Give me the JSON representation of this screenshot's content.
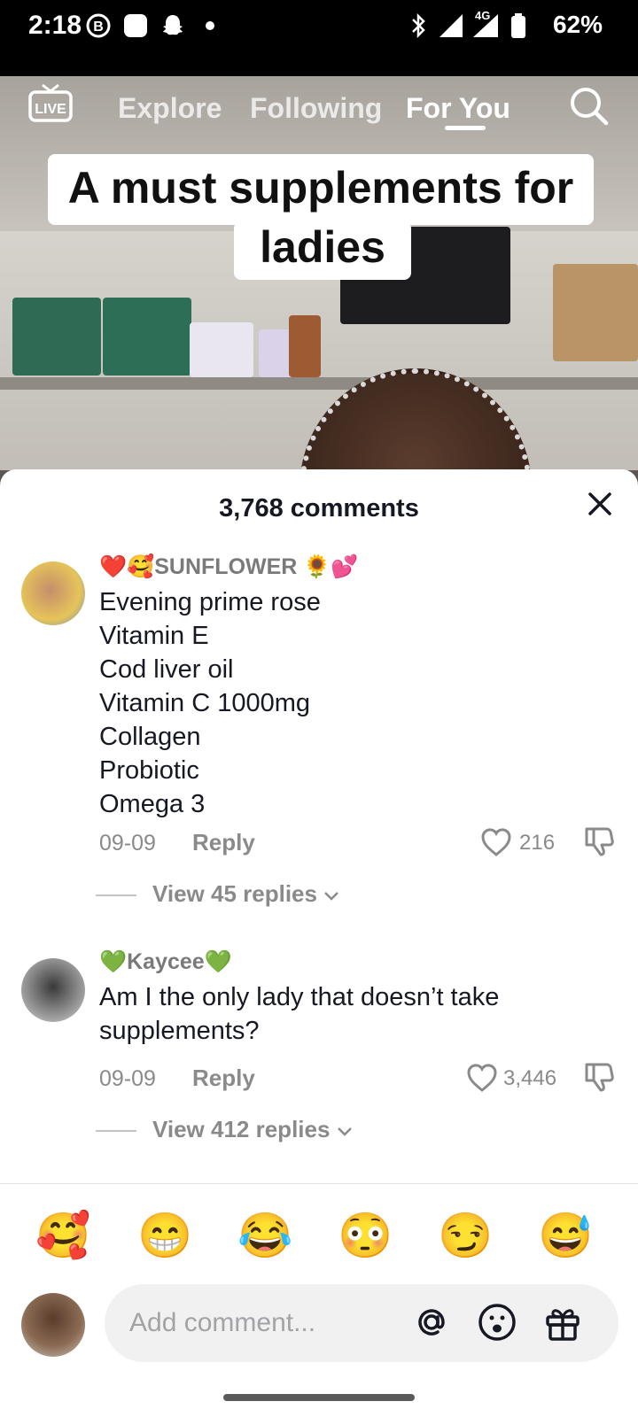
{
  "status_bar": {
    "time": "2:18",
    "battery": "62%",
    "network": "4G"
  },
  "top_nav": {
    "tabs": [
      {
        "label": "Explore",
        "active": false
      },
      {
        "label": "Following",
        "active": false
      },
      {
        "label": "For You",
        "active": true
      }
    ],
    "live_icon": "LIVE"
  },
  "video": {
    "caption_line1": "A must supplements for",
    "caption_line2": "ladies"
  },
  "comments_sheet": {
    "title": "3,768 comments",
    "comments": [
      {
        "username": "❤️🥰SUNFLOWER 🌻💕",
        "text": "Evening prime rose\nVitamin E\nCod liver oil\nVitamin C 1000mg\nCollagen\nProbiotic\nOmega 3",
        "date": "09-09",
        "reply_label": "Reply",
        "likes": "216",
        "view_replies": "View 45 replies"
      },
      {
        "username": "💚Kaycee💚",
        "text": "Am I the only lady that doesn’t take\nsupplements?",
        "date": "09-09",
        "reply_label": "Reply",
        "likes": "3,446",
        "view_replies": "View 412 replies"
      }
    ]
  },
  "emoji_bar": [
    "🥰",
    "😁",
    "😂",
    "😳",
    "😏",
    "😅"
  ],
  "comment_input": {
    "placeholder": "Add comment..."
  },
  "colors": {
    "text_primary": "#161823",
    "text_secondary": "#8a8a8a",
    "input_bg": "#f1f1f2"
  }
}
